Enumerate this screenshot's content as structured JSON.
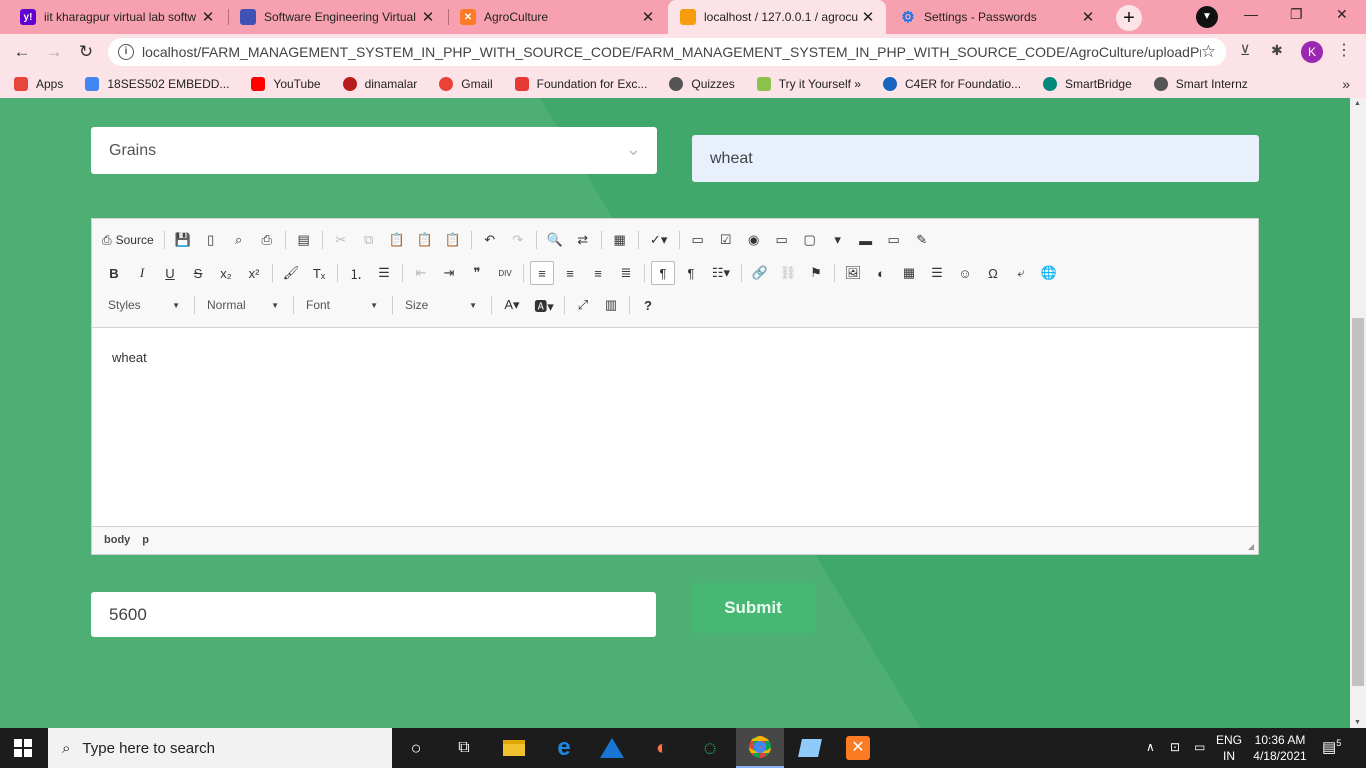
{
  "browser": {
    "tabs": [
      {
        "title": "iit kharagpur virtual lab softw",
        "icon": "yahoo-icon",
        "color": "#6001d2"
      },
      {
        "title": "Software Engineering Virtual",
        "icon": "vlab-icon",
        "color": "#3f51b5"
      },
      {
        "title": "AgroCulture",
        "icon": "xampp-icon",
        "color": "#fb7a24"
      },
      {
        "title": "localhost / 127.0.0.1 / agrocu",
        "icon": "phpmyadmin-icon",
        "color": "#f89c0e"
      },
      {
        "title": "Settings - Passwords",
        "icon": "gear-icon",
        "color": "#1a73e8"
      }
    ],
    "url": "localhost/FARM_MANAGEMENT_SYSTEM_IN_PHP_WITH_SOURCE_CODE/FARM_MANAGEMENT_SYSTEM_IN_PHP_WITH_SOURCE_CODE/AgroCulture/uploadProduct.php",
    "profile_initial": "K",
    "bookmarks": [
      {
        "label": "Apps",
        "color": "#e8453c"
      },
      {
        "label": "18SES502 EMBEDD...",
        "color": "#4285f4"
      },
      {
        "label": "YouTube",
        "color": "#ff0000"
      },
      {
        "label": "dinamalar",
        "color": "#b71c1c"
      },
      {
        "label": "Gmail",
        "color": "#ea4335"
      },
      {
        "label": "Foundation for Exc...",
        "color": "#e53935"
      },
      {
        "label": "Quizzes",
        "color": "#555555"
      },
      {
        "label": "Try it Yourself »",
        "color": "#8bc34a"
      },
      {
        "label": "C4ER for Foundatio...",
        "color": "#1565c0"
      },
      {
        "label": "SmartBridge",
        "color": "#00897b"
      },
      {
        "label": "Smart Internz",
        "color": "#555555"
      }
    ]
  },
  "form": {
    "category": "Grains",
    "product_name": "wheat",
    "editor": {
      "source_label": "Source",
      "styles_label": "Styles",
      "format_label": "Normal",
      "font_label": "Font",
      "size_label": "Size",
      "content": "wheat",
      "path": [
        "body",
        "p"
      ]
    },
    "price": "5600",
    "submit_label": "Submit"
  },
  "taskbar": {
    "search_placeholder": "Type here to search",
    "lang_top": "ENG",
    "lang_bottom": "IN",
    "time": "10:36 AM",
    "date": "4/18/2021",
    "notification_count": "5"
  },
  "colors": {
    "page_bg": "#40a86a",
    "page_light": "#57b47a",
    "chrome_pink": "#f7a1b0",
    "submit_bg": "#47b774"
  }
}
